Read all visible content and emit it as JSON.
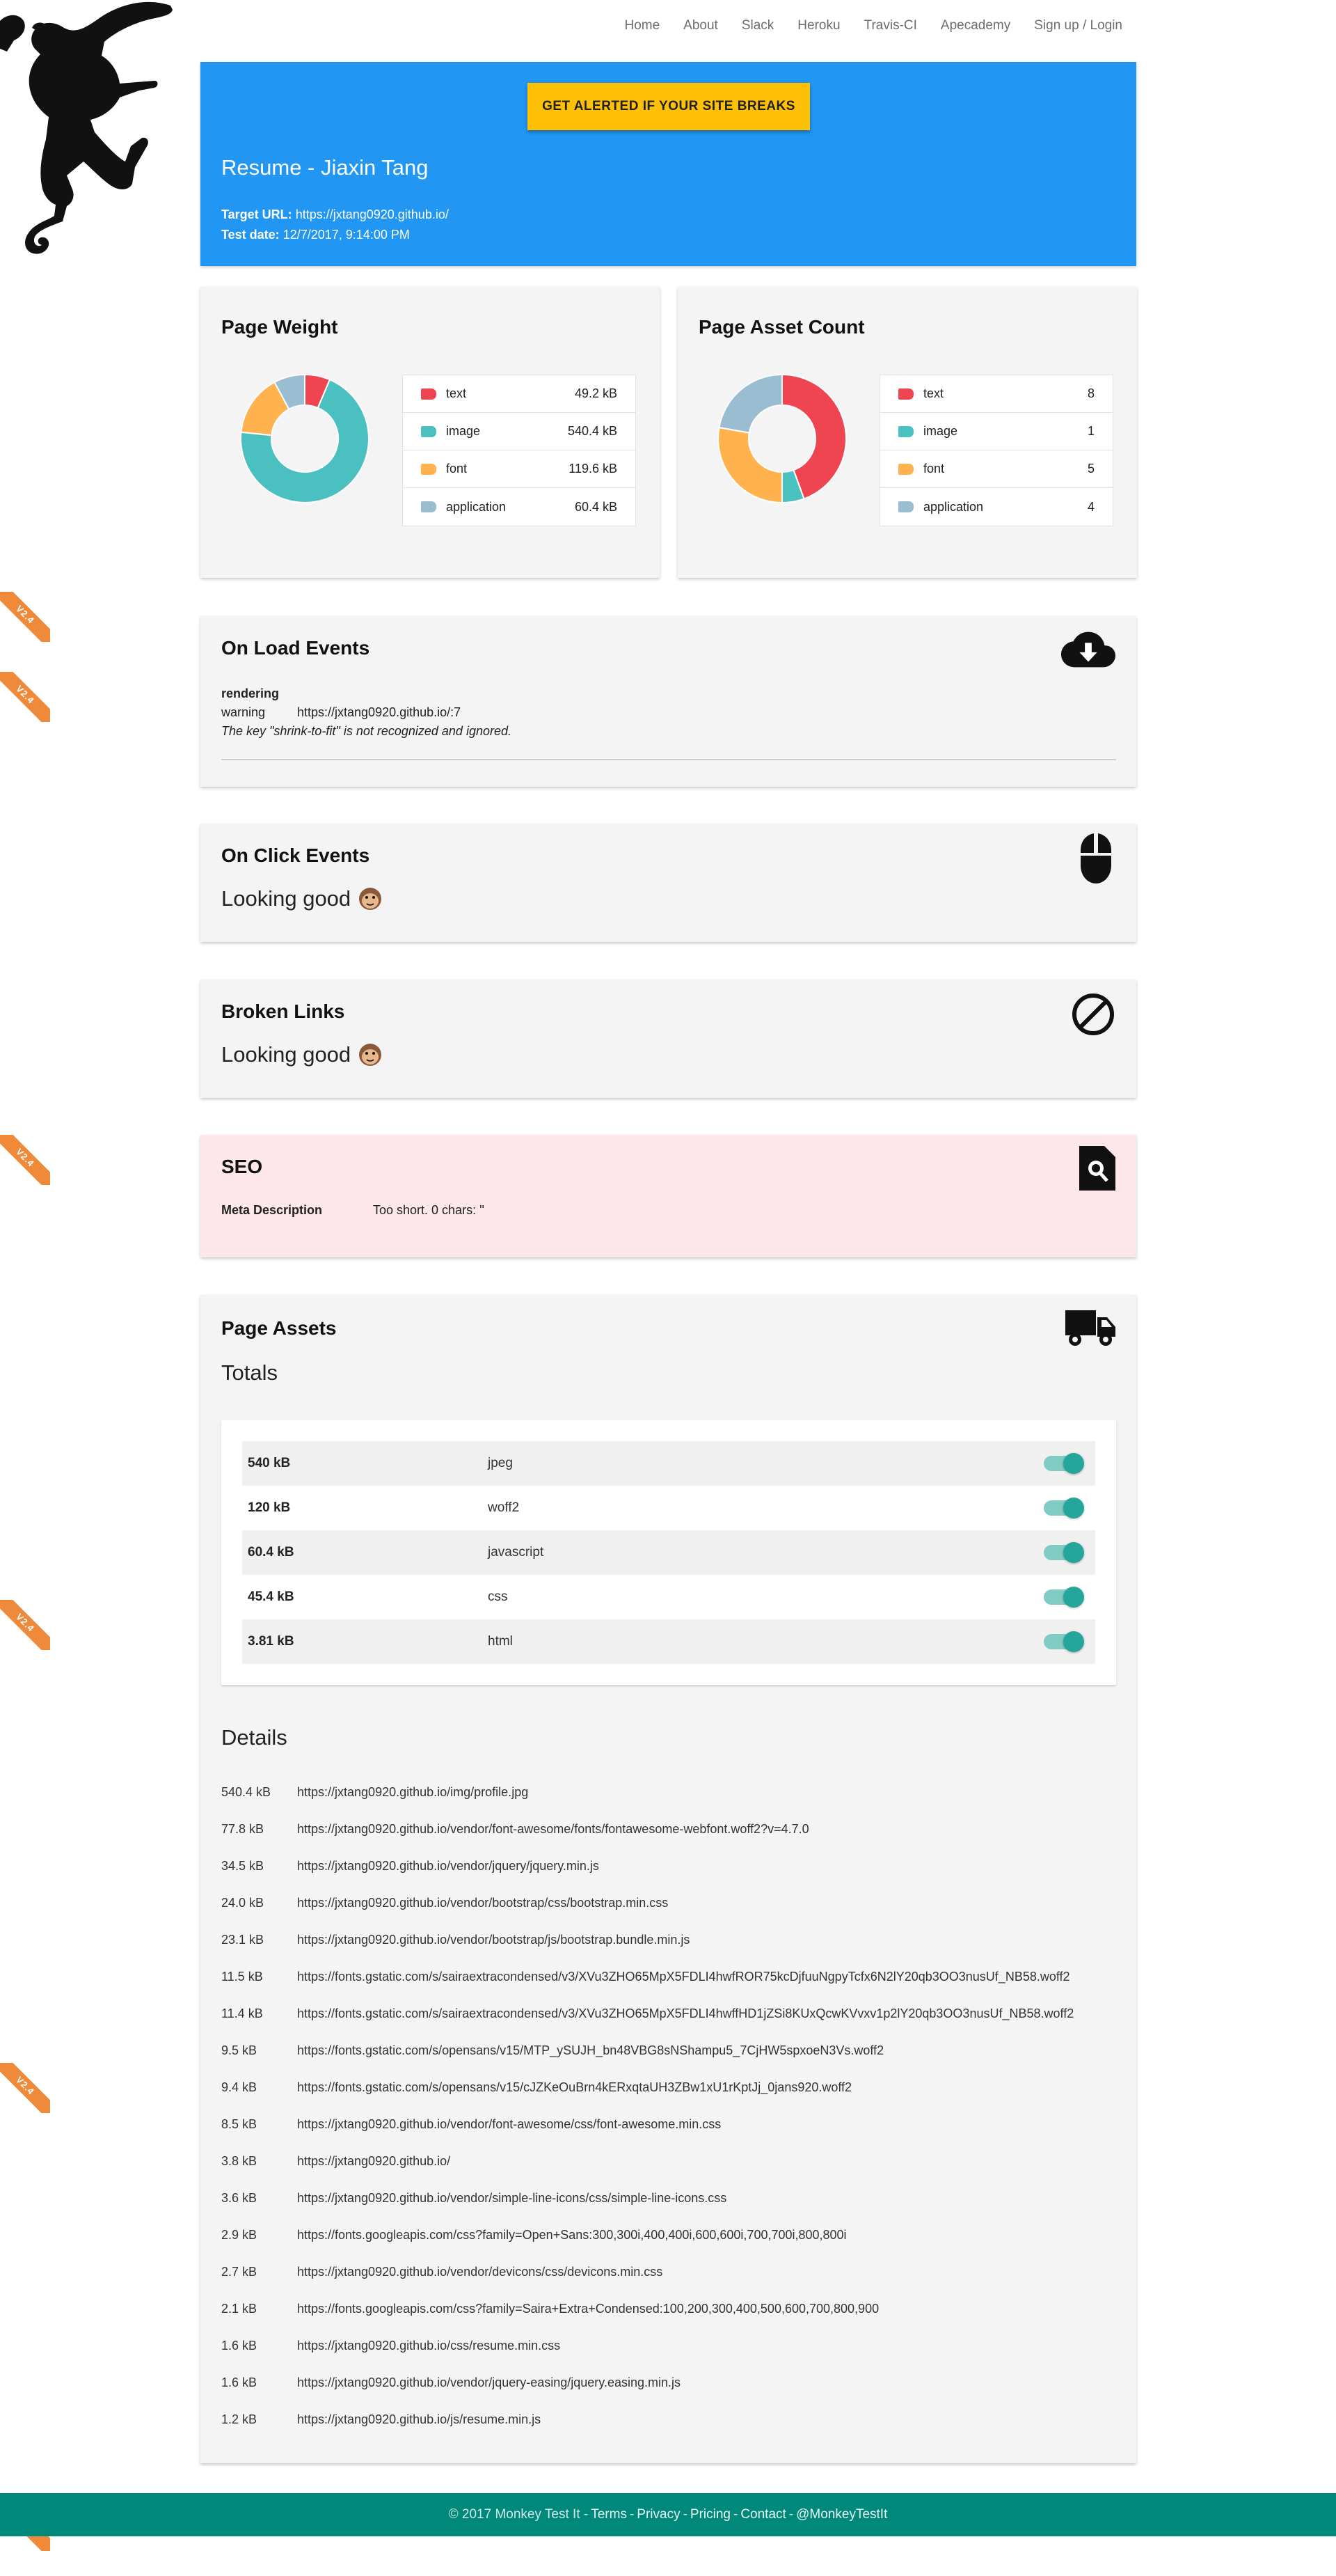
{
  "nav": [
    "Home",
    "About",
    "Slack",
    "Heroku",
    "Travis-CI",
    "Apecademy",
    "Sign up / Login"
  ],
  "ribbon_label": "V2.4",
  "hero": {
    "button": "GET ALERTED IF YOUR SITE BREAKS",
    "title": "Resume - Jiaxin Tang",
    "target_label": "Target URL:",
    "target_value": "https://jxtang0920.github.io/",
    "date_label": "Test date:",
    "date_value": "12/7/2017, 9:14:00 PM"
  },
  "weight": {
    "title": "Page Weight",
    "items": [
      {
        "label": "text",
        "value": "49.2 kB",
        "num": 49.2,
        "color": "#ef4550"
      },
      {
        "label": "image",
        "value": "540.4 kB",
        "num": 540.4,
        "color": "#4bc0c0"
      },
      {
        "label": "font",
        "value": "119.6 kB",
        "num": 119.6,
        "color": "#ffb24e"
      },
      {
        "label": "application",
        "value": "60.4 kB",
        "num": 60.4,
        "color": "#9bbdd1"
      }
    ]
  },
  "count": {
    "title": "Page Asset Count",
    "items": [
      {
        "label": "text",
        "value": "8",
        "num": 8,
        "color": "#ef4550"
      },
      {
        "label": "image",
        "value": "1",
        "num": 1,
        "color": "#4bc0c0"
      },
      {
        "label": "font",
        "value": "5",
        "num": 5,
        "color": "#ffb24e"
      },
      {
        "label": "application",
        "value": "4",
        "num": 4,
        "color": "#9bbdd1"
      }
    ]
  },
  "onload": {
    "title": "On Load Events",
    "category": "rendering",
    "level": "warning",
    "location": "https://jxtang0920.github.io/:7",
    "message": "The key \"shrink-to-fit\" is not recognized and ignored."
  },
  "onclick": {
    "title": "On Click Events",
    "status": "Looking good"
  },
  "broken": {
    "title": "Broken Links",
    "status": "Looking good"
  },
  "seo": {
    "title": "SEO",
    "label": "Meta Description",
    "value": "Too short. 0 chars: ''"
  },
  "assets": {
    "title": "Page Assets",
    "totals_title": "Totals",
    "totals": [
      {
        "size": "540 kB",
        "type": "jpeg"
      },
      {
        "size": "120 kB",
        "type": "woff2"
      },
      {
        "size": "60.4 kB",
        "type": "javascript"
      },
      {
        "size": "45.4 kB",
        "type": "css"
      },
      {
        "size": "3.81 kB",
        "type": "html"
      }
    ],
    "details_title": "Details",
    "details": [
      {
        "size": "540.4 kB",
        "url": "https://jxtang0920.github.io/img/profile.jpg"
      },
      {
        "size": "77.8 kB",
        "url": "https://jxtang0920.github.io/vendor/font-awesome/fonts/fontawesome-webfont.woff2?v=4.7.0"
      },
      {
        "size": "34.5 kB",
        "url": "https://jxtang0920.github.io/vendor/jquery/jquery.min.js"
      },
      {
        "size": "24.0 kB",
        "url": "https://jxtang0920.github.io/vendor/bootstrap/css/bootstrap.min.css"
      },
      {
        "size": "23.1 kB",
        "url": "https://jxtang0920.github.io/vendor/bootstrap/js/bootstrap.bundle.min.js"
      },
      {
        "size": "11.5 kB",
        "url": "https://fonts.gstatic.com/s/sairaextracondensed/v3/XVu3ZHO65MpX5FDLI4hwfROR75kcDjfuuNgpyTcfx6N2lY20qb3OO3nusUf_NB58.woff2"
      },
      {
        "size": "11.4 kB",
        "url": "https://fonts.gstatic.com/s/sairaextracondensed/v3/XVu3ZHO65MpX5FDLI4hwffHD1jZSi8KUxQcwKVvxv1p2lY20qb3OO3nusUf_NB58.woff2"
      },
      {
        "size": "9.5 kB",
        "url": "https://fonts.gstatic.com/s/opensans/v15/MTP_ySUJH_bn48VBG8sNShampu5_7CjHW5spxoeN3Vs.woff2"
      },
      {
        "size": "9.4 kB",
        "url": "https://fonts.gstatic.com/s/opensans/v15/cJZKeOuBrn4kERxqtaUH3ZBw1xU1rKptJj_0jans920.woff2"
      },
      {
        "size": "8.5 kB",
        "url": "https://jxtang0920.github.io/vendor/font-awesome/css/font-awesome.min.css"
      },
      {
        "size": "3.8 kB",
        "url": "https://jxtang0920.github.io/"
      },
      {
        "size": "3.6 kB",
        "url": "https://jxtang0920.github.io/vendor/simple-line-icons/css/simple-line-icons.css"
      },
      {
        "size": "2.9 kB",
        "url": "https://fonts.googleapis.com/css?family=Open+Sans:300,300i,400,400i,600,600i,700,700i,800,800i"
      },
      {
        "size": "2.7 kB",
        "url": "https://jxtang0920.github.io/vendor/devicons/css/devicons.min.css"
      },
      {
        "size": "2.1 kB",
        "url": "https://fonts.googleapis.com/css?family=Saira+Extra+Condensed:100,200,300,400,500,600,700,800,900"
      },
      {
        "size": "1.6 kB",
        "url": "https://jxtang0920.github.io/css/resume.min.css"
      },
      {
        "size": "1.6 kB",
        "url": "https://jxtang0920.github.io/vendor/jquery-easing/jquery.easing.min.js"
      },
      {
        "size": "1.2 kB",
        "url": "https://jxtang0920.github.io/js/resume.min.js"
      }
    ]
  },
  "footer": {
    "copyright": "© 2017 Monkey Test It -",
    "links": [
      "Terms",
      "Privacy",
      "Pricing",
      "Contact",
      "@MonkeyTestIt"
    ]
  },
  "colors": {
    "hero": "#2196f3",
    "button": "#ffc107",
    "footer": "#00897b",
    "ribbon": "#ee8a39",
    "seo_bg": "#fde7ea",
    "toggle": "#26a69a"
  }
}
